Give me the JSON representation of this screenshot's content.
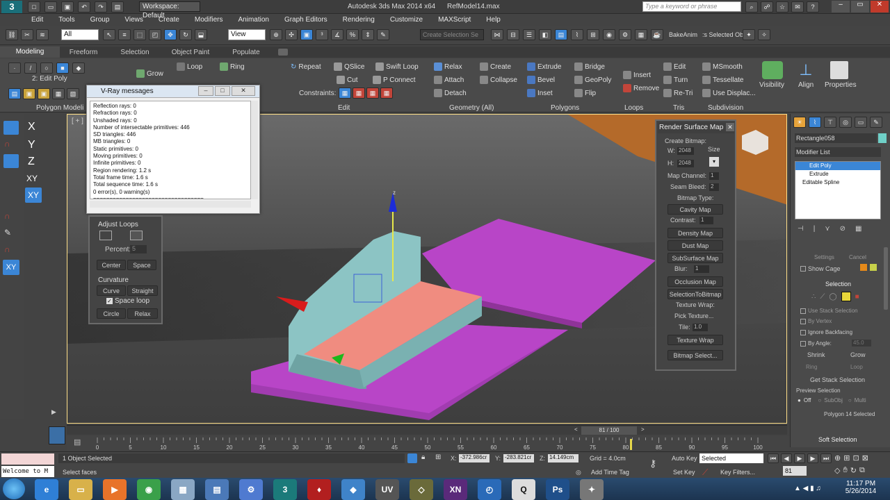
{
  "window": {
    "title": "Autodesk 3ds Max 2014 x64",
    "file": "RefModel14.max",
    "workspace": "Workspace: Default",
    "search_placeholder": "Type a keyword or phrase"
  },
  "menu": [
    "Edit",
    "Tools",
    "Group",
    "Views",
    "Create",
    "Modifiers",
    "Animation",
    "Graph Editors",
    "Rendering",
    "Customize",
    "MAXScript",
    "Help"
  ],
  "toolbar": {
    "filter": "All",
    "view": "View",
    "selection_set": "Create Selection Se",
    "bake_anim": "BakeAnim",
    "selected_obj": ":s Selected Obj"
  },
  "ribbon_tabs": [
    "Modeling",
    "Freeform",
    "Selection",
    "Object Paint",
    "Populate"
  ],
  "ribbon": {
    "edit_poly_label": "2: Edit Poly",
    "polygon_modeling": "Polygon Modeli",
    "grow": "Grow",
    "loop": "Loop",
    "ring": "Ring",
    "repeat": "Repeat",
    "qslice": "QSlice",
    "swift_loop": "Swift Loop",
    "cut": "Cut",
    "p_connect": "P Connect",
    "constraints": "Constraints:",
    "edit_group": "Edit",
    "relax": "Relax",
    "create": "Create",
    "attach": "Attach",
    "collapse": "Collapse",
    "detach": "Detach",
    "geometry_all": "Geometry (All)",
    "extrude": "Extrude",
    "bridge": "Bridge",
    "bevel": "Bevel",
    "geopoly": "GeoPoly",
    "inset": "Inset",
    "flip": "Flip",
    "polygons": "Polygons",
    "insert": "Insert",
    "remove": "Remove",
    "loops": "Loops",
    "edit": "Edit",
    "turn": "Turn",
    "retri": "Re-Tri",
    "tris": "Tris",
    "msmooth": "MSmooth",
    "tessellate": "Tessellate",
    "use_displac": "Use Displac...",
    "subdivision": "Subdivision",
    "visibility": "Visibility",
    "align": "Align",
    "properties": "Properties"
  },
  "vray": {
    "title": "V-Ray messages",
    "lines": [
      "Reflection rays: 0",
      "Refraction rays: 0",
      "Unshaded rays: 0",
      "Number of intersectable primitives: 446",
      "SD triangles: 446",
      "MB triangles: 0",
      "Static primitives: 0",
      "Moving primitives: 0",
      "Infinite primitives: 0",
      "Region rendering: 1.2 s",
      "Total frame time: 1.6 s",
      "Total sequence time: 1.6 s",
      "0 error(s), 0 warning(s)",
      "=================================="
    ]
  },
  "adjust_loops": {
    "title": "Adjust Loops",
    "percent_label": "Percent:",
    "percent_value": "5",
    "center": "Center",
    "space": "Space",
    "curvature_title": "Curvature",
    "curve": "Curve",
    "straight": "Straight",
    "space_loop": "Space loop",
    "circle": "Circle",
    "relax": "Relax"
  },
  "left_toolbar": [
    "X",
    "Y",
    "Z",
    "XY",
    "XY",
    "XY"
  ],
  "render_surface_map": {
    "title": "Render Surface Map",
    "create_bitmap": "Create Bitmap:",
    "w_label": "W:",
    "w_value": "2048",
    "h_label": "H:",
    "h_value": "2048",
    "size_label": "Size",
    "map_channel_label": "Map Channel:",
    "map_channel_value": "1",
    "seam_bleed_label": "Seam Bleed:",
    "seam_bleed_value": "2",
    "bitmap_type": "Bitmap Type:",
    "cavity_map": "Cavity Map",
    "contrast_label": "Contrast:",
    "contrast_value": "1",
    "density_map": "Density Map",
    "dust_map": "Dust Map",
    "subsurface_map": "SubSurface Map",
    "blur_label": "Blur:",
    "blur_value": "1",
    "occlusion_map": "Occlusion Map",
    "selection_to_bitmap": "SelectionToBitmap",
    "texture_wrap_label": "Texture Wrap:",
    "pick_texture": "Pick Texture...",
    "tile_label": "Tile:",
    "tile_value": "1.0",
    "texture_wrap": "Texture Wrap",
    "bitmap_select": "Bitmap Select..."
  },
  "viewport": {
    "label": "[ + ]",
    "gizmo_z": "z"
  },
  "command_panel": {
    "object_name": "Rectangle058",
    "modifier_list": "Modifier List",
    "stack": [
      "Edit Poly",
      "Extrude",
      "Editable Spline"
    ],
    "settings": "Settings",
    "cancel": "Cancel",
    "show_cage": "Show Cage",
    "selection": "Selection",
    "use_stack_selection": "Use Stack Selection",
    "by_vertex": "By Vertex",
    "ignore_backfacing": "Ignore Backfacing",
    "by_angle": "By Angle:",
    "by_angle_value": "45.0",
    "shrink": "Shrink",
    "grow": "Grow",
    "ring": "Ring",
    "loop": "Loop",
    "get_stack_selection": "Get Stack Selection",
    "preview_selection": "Preview Selection",
    "off": "Off",
    "subobj": "SubObj",
    "multi": "Multi",
    "status": "Polygon 14 Selected",
    "soft_selection": "Soft Selection"
  },
  "timeline": {
    "frame": "81 / 100",
    "ticks": [
      "0",
      "5",
      "10",
      "15",
      "20",
      "25",
      "30",
      "35",
      "40",
      "45",
      "50",
      "55",
      "60",
      "65",
      "70",
      "75",
      "80",
      "85",
      "90",
      "95",
      "100"
    ],
    "current_fraction": 0.81
  },
  "status": {
    "maxscript": "Welcome to M",
    "objects": "1 Object Selected",
    "prompt": "Select faces",
    "x": "-372.986cr",
    "y": "-283.821cr",
    "z": "14.149cm",
    "grid": "Grid = 4.0cm",
    "add_time_tag": "Add Time Tag",
    "auto_key": "Auto Key",
    "set_key": "Set Key",
    "selected": "Selected",
    "key_filters": "Key Filters...",
    "frame_value": "81"
  },
  "taskbar": {
    "time": "11:17 PM",
    "date": "5/26/2014",
    "apps": [
      "ie",
      "explorer",
      "media",
      "chrome",
      "calc",
      "file",
      "network",
      "3dsmax",
      "flash",
      "blender",
      "uv",
      "app",
      "xn",
      "clock",
      "q",
      "photoshop",
      "app2"
    ]
  },
  "colors": {
    "pink_face": "#f08c80",
    "teal": "#86b8b8",
    "purple": "#b33fc2",
    "accent_blue": "#3b86d6"
  }
}
